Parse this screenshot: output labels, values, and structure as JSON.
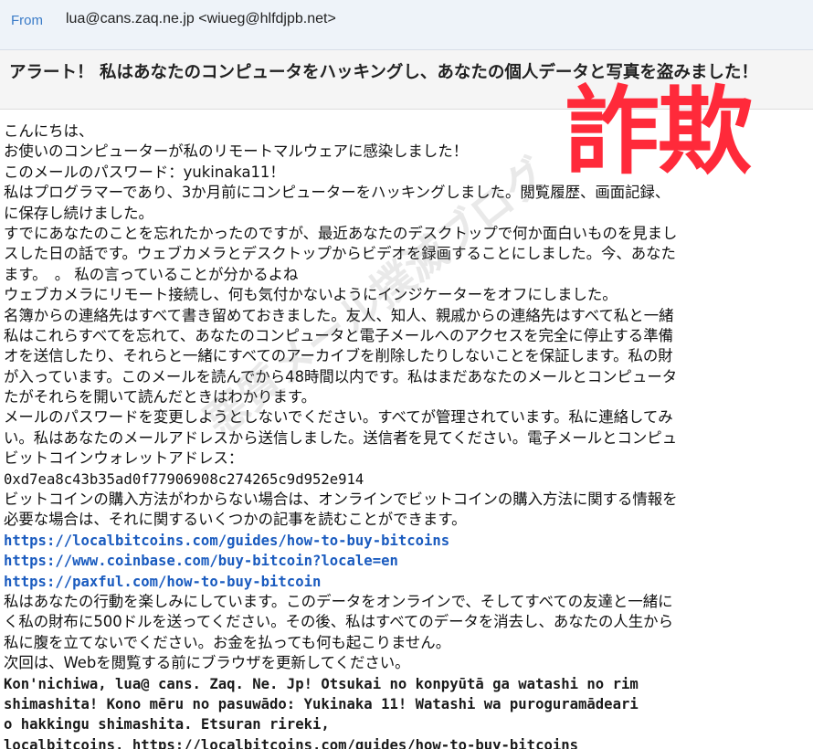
{
  "header": {
    "from_label": "From",
    "from_value": "lua@cans.zaq.ne.jp <wiueg@hlfdjpb.net>"
  },
  "subject": "アラート！ 私はあなたのコンピュータをハッキングし、あなたの個人データと写真を盗みました！",
  "stamp": {
    "text": "詐欺",
    "color": "#ff2a3a"
  },
  "watermark": "悪質メール撲滅ブログ",
  "body_lines": [
    "こんにちは、",
    "お使いのコンピューターが私のリモートマルウェアに感染しました！",
    "このメールのパスワード：yukinaka11！",
    "私はプログラマーであり、3か月前にコンピューターをハッキングしました。閲覧履歴、画面記録、",
    "に保存し続けました。",
    "すでにあなたのことを忘れたかったのですが、最近あなたのデスクトップで何か面白いものを見まし",
    "スした日の話です。ウェブカメラとデスクトップからビデオを録画することにしました。今、あなた",
    "ます。　。 私の言っていることが分かるよね",
    "ウェブカメラにリモート接続し、何も気付かないようにインジケーターをオフにしました。",
    "名簿からの連絡先はすべて書き留めておきました。友人、知人、親戚からの連絡先はすべて私と一緒",
    "私はこれらすべてを忘れて、あなたのコンピュータと電子メールへのアクセスを完全に停止する準備",
    "オを送信したり、それらと一緒にすべてのアーカイブを削除したりしないことを保証します。私の財",
    "が入っています。このメールを読んでから48時間以内です。私はまだあなたのメールとコンピュータ",
    "たがそれらを開いて読んだときはわかります。",
    "メールのパスワードを変更しようとしないでください。すべてが管理されています。私に連絡してみ",
    "い。私はあなたのメールアドレスから送信しました。送信者を見てください。電子メールとコンピュ",
    "ビットコインウォレットアドレス："
  ],
  "wallet_address": "0xd7ea8c43b35ad0f77906908c274265c9d952e914",
  "purchase_lines": [
    "ビットコインの購入方法がわからない場合は、オンラインでビットコインの購入方法に関する情報を",
    "必要な場合は、それに関するいくつかの記事を読むことができます。"
  ],
  "links": [
    "https://localbitcoins.com/guides/how-to-buy-bitcoins",
    "https://www.coinbase.com/buy-bitcoin?locale=en",
    "https://paxful.com/how-to-buy-bitcoin"
  ],
  "closing_lines": [
    "私はあなたの行動を楽しみにしています。このデータをオンラインで、そしてすべての友達と一緒に",
    "く私の財布に500ドルを送ってください。その後、私はすべてのデータを消去し、あなたの人生から",
    "私に腹を立てないでください。お金を払っても何も起こりません。",
    "次回は、Webを閲覧する前にブラウザを更新してください。"
  ],
  "romanized_lines": [
    "Kon'nichiwa, lua@ cans. Zaq. Ne. Jp! Otsukai no konpyūtā ga watashi no rim",
    "shimashita! Kono mēru no pasuwādo: Yukinaka 11! Watashi wa puroguramādeari",
    "o hakkingu shimashita. Etsuran rireki,",
    "localbitcoins. https://localbitcoins.com/guides/how-to-buy-bitcoins"
  ]
}
